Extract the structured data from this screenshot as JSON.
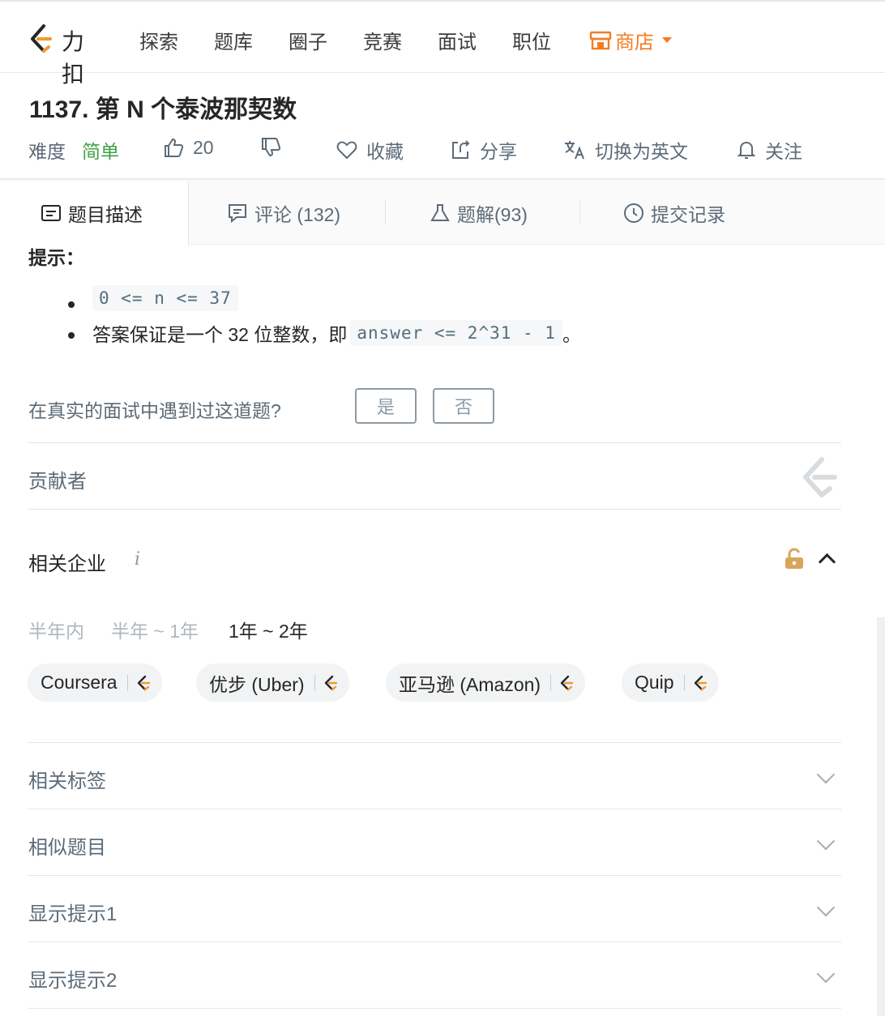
{
  "nav": {
    "logo_text": "力扣",
    "items": [
      "探索",
      "题库",
      "圈子",
      "竞赛",
      "面试",
      "职位"
    ],
    "store_label": "商店"
  },
  "problem": {
    "title": "1137. 第 N 个泰波那契数",
    "difficulty_label": "难度",
    "difficulty_value": "简单",
    "likes": "20",
    "favorite_label": "收藏",
    "share_label": "分享",
    "switch_lang_label": "切换为英文",
    "follow_label": "关注"
  },
  "tabs": [
    {
      "label": "题目描述"
    },
    {
      "label": "评论 (132)"
    },
    {
      "label": "题解(93)"
    },
    {
      "label": "提交记录"
    }
  ],
  "content": {
    "hint_label": "提示：",
    "constraint_code": "0 <= n <= 37",
    "guarantee_prefix": "答案保证是一个 32 位整数，即 ",
    "guarantee_code": "answer <= 2^31 - 1",
    "guarantee_suffix": "。"
  },
  "interview": {
    "question": "在真实的面试中遇到过这道题?",
    "yes": "是",
    "no": "否"
  },
  "contributors": {
    "label": "贡献者"
  },
  "companies": {
    "title": "相关企业",
    "info": "i",
    "periods": [
      "半年内",
      "半年 ~ 1年",
      "1年 ~ 2年"
    ],
    "active_period": "1年 ~ 2年",
    "chips": [
      "Coursera",
      "优步 (Uber)",
      "亚马逊 (Amazon)",
      "Quip"
    ]
  },
  "sections": [
    "相关标签",
    "相似题目",
    "显示提示1",
    "显示提示2"
  ],
  "colors": {
    "brand_orange": "#f47c23",
    "easy_green": "#43a047",
    "text_gray": "#5c6b78"
  }
}
